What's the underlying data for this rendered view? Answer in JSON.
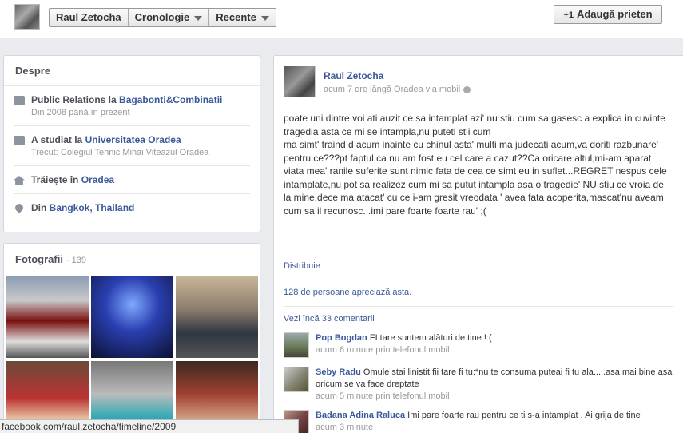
{
  "topbar": {
    "name_button": "Raul Zetocha",
    "timeline_button": "Cronologie",
    "recent_button": "Recente",
    "add_friend": "Adaugă prieten",
    "add_friend_icon": "+1"
  },
  "about": {
    "title": "Despre",
    "work": {
      "prefix": "Public Relations la ",
      "link": "Bagabonti&Combinatii",
      "sub": "Din 2008 până în prezent"
    },
    "school": {
      "prefix": "A studiat la ",
      "link": "Universitatea Oradea",
      "sub": "Trecut: Colegiul Tehnic Mihai Viteazul Oradea"
    },
    "lives": {
      "prefix": "Trăiește în ",
      "link": "Oradea"
    },
    "from": {
      "prefix": "Din ",
      "link": "Bangkok, Thailand"
    }
  },
  "photos": {
    "title": "Fotografii",
    "count": "· 139"
  },
  "post": {
    "author": "Raul Zetocha",
    "meta": "acum 7 ore lângă Oradea via mobil",
    "line1": "poate uni dintre voi ati auzit ce sa intamplat azi' nu stiu cum sa gasesc a explica in cuvinte tragedia asta ce mi se intampla,nu puteti stii cum",
    "line2": "ma simt' traind d acum inainte cu chinul asta' multi ma judecati acum,va doriti razbunare' pentru ce???pt faptul ca nu am fost eu cel care a cazut??Ca oricare altul,mi-am aparat viata mea' ranile suferite sunt nimic fata de cea ce simt eu in suflet...REGRET nespus cele intamplate,nu pot sa realizez cum mi sa putut intampla asa o tragedie' NU stiu ce vroia de la mine,dece ma atacat' cu ce i-am gresit vreodata ' avea fata acoperita,mascat'nu aveam cum sa il recunosc...imi pare foarte foarte rau' ;(",
    "share": "Distribuie",
    "likes": "128 de persoane apreciază asta.",
    "more_comments": "Vezi încă 33 comentarii"
  },
  "comments": [
    {
      "name": "Pop Bogdan",
      "text": "FI tare suntem alături de tine !:(",
      "time": "acum 6 minute prin telefonul mobil"
    },
    {
      "name": "Seby Radu",
      "text": "Omule stai linistit fii tare fi tu:*nu te consuma puteai fi tu ala.....asa mai bine asa oricum se va face dreptate",
      "time": "acum 5 minute prin telefonul mobil"
    },
    {
      "name": "Badana Adina Raluca",
      "text": "Imi pare foarte rau pentru ce ti s-a intamplat . Ai grija de tine",
      "time": "acum 3 minute"
    }
  ],
  "statusbar": {
    "url": "facebook.com/raul.zetocha/timeline/2009"
  }
}
